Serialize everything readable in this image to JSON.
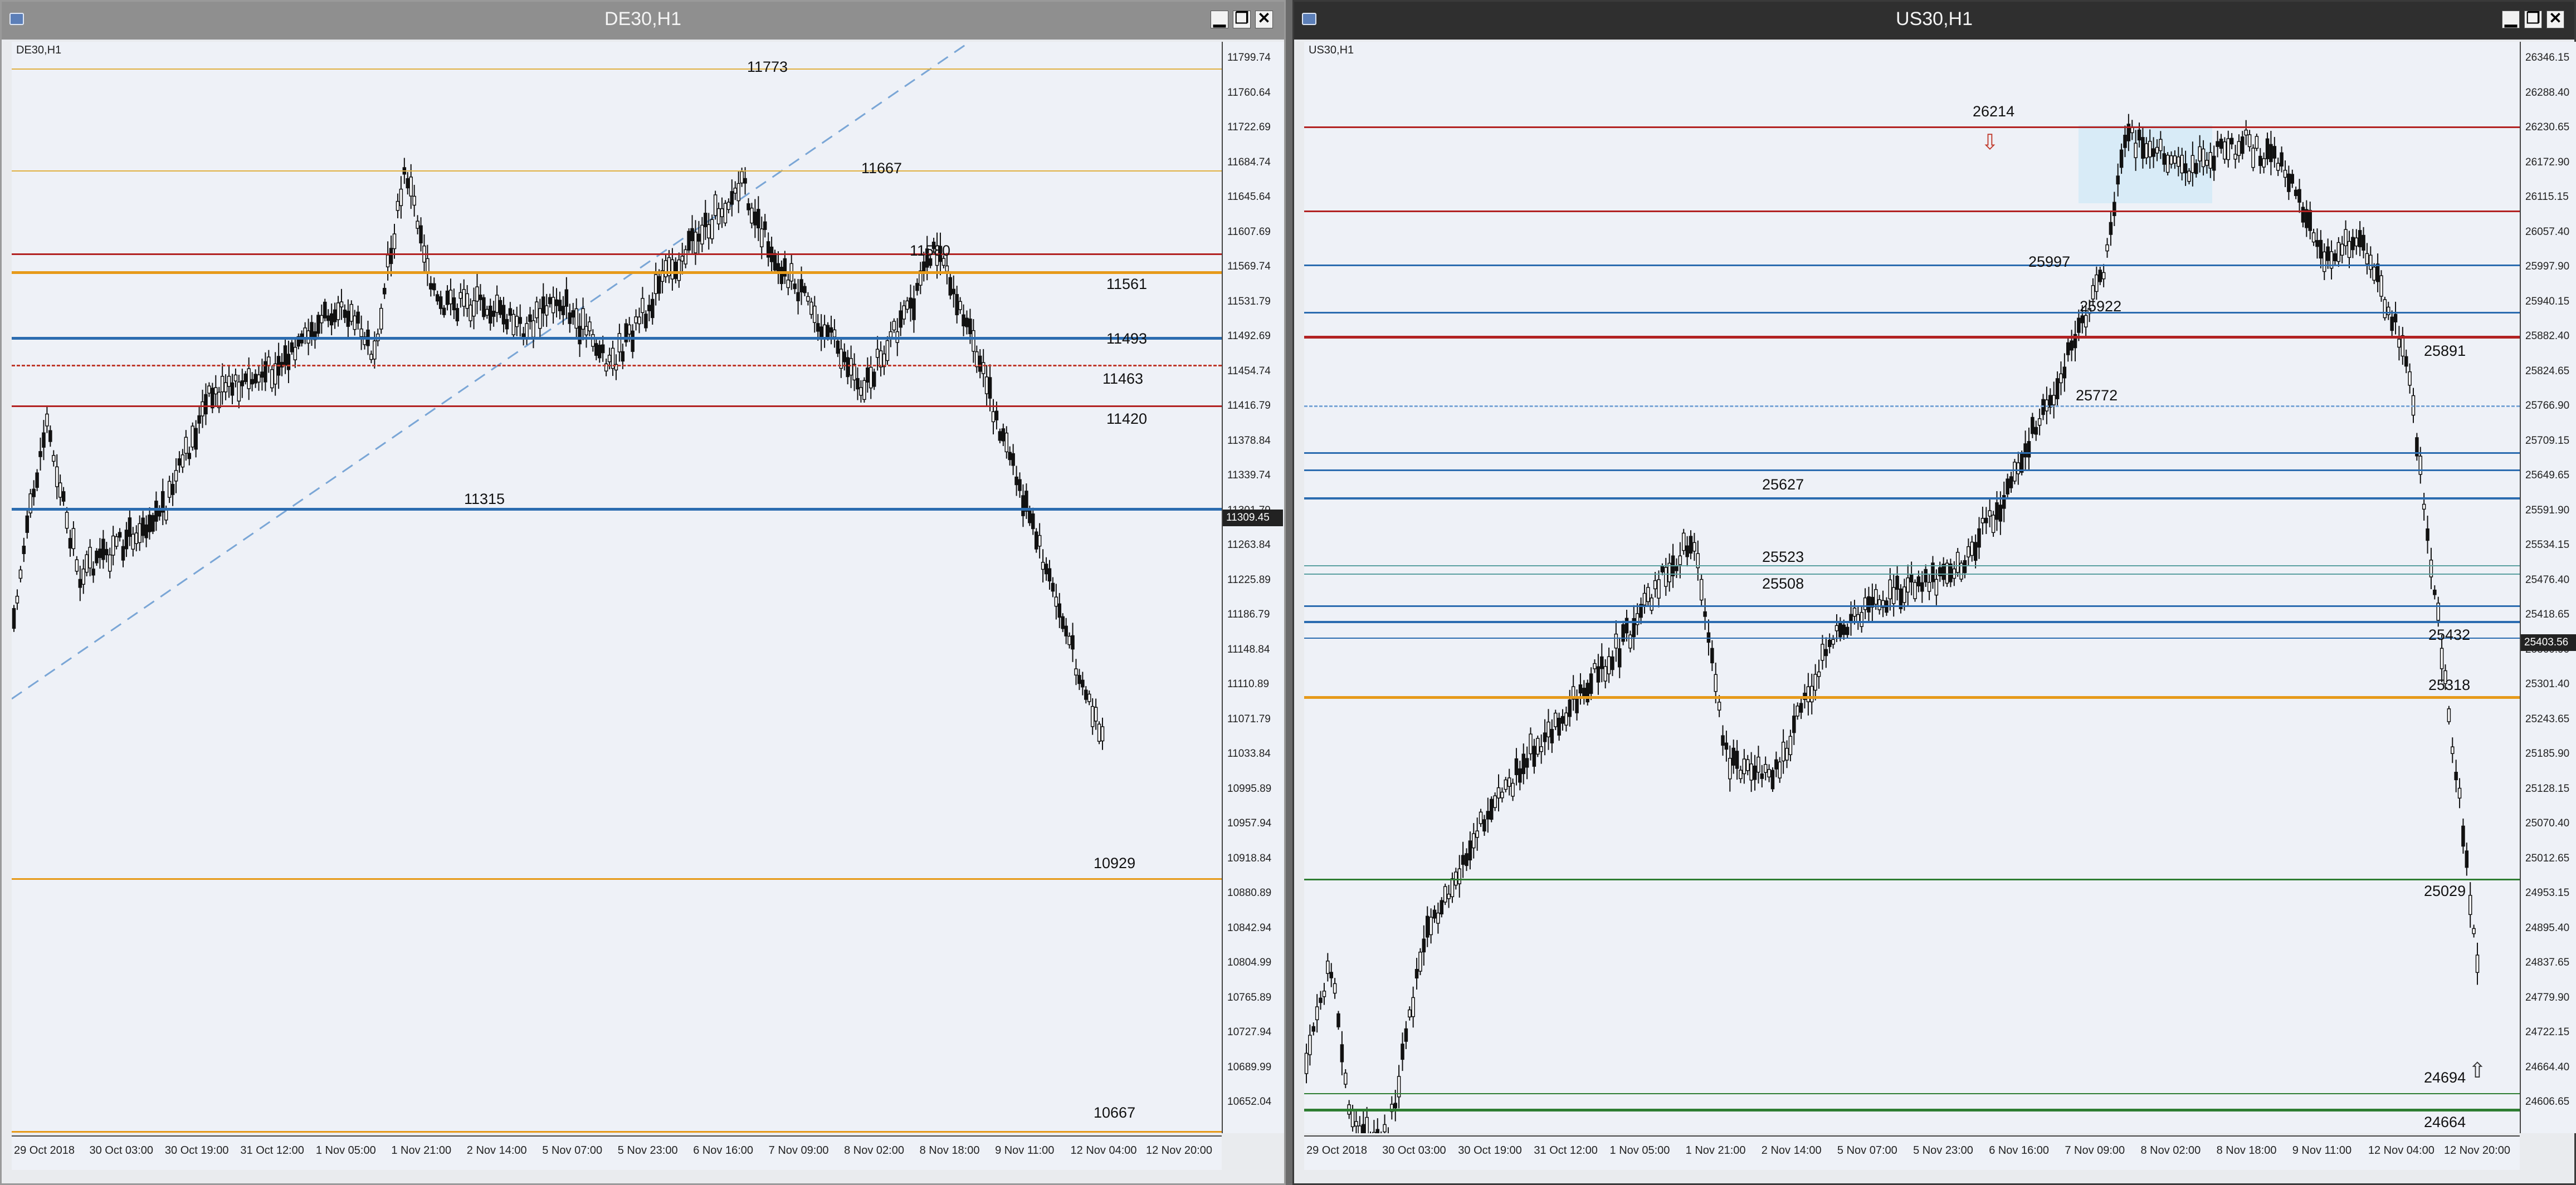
{
  "left": {
    "title": "DE30,H1",
    "symbol_label": "DE30,H1",
    "y_ticks": [
      "11799.74",
      "11760.64",
      "11722.69",
      "11684.74",
      "11645.64",
      "11607.69",
      "11569.74",
      "11531.79",
      "11492.69",
      "11454.74",
      "11416.79",
      "11378.84",
      "11339.74",
      "11301.79",
      "11263.84",
      "11225.89",
      "11186.79",
      "11148.84",
      "11110.89",
      "11071.79",
      "11033.84",
      "10995.89",
      "10957.94",
      "10918.84",
      "10880.89",
      "10842.94",
      "10804.99",
      "10765.89",
      "10727.94",
      "10689.99",
      "10652.04"
    ],
    "current_price": "11309.45",
    "x_ticks": [
      "29 Oct 2018",
      "30 Oct 03:00",
      "30 Oct 19:00",
      "31 Oct 12:00",
      "1 Nov 05:00",
      "1 Nov 21:00",
      "2 Nov 14:00",
      "5 Nov 07:00",
      "5 Nov 23:00",
      "6 Nov 16:00",
      "7 Nov 09:00",
      "8 Nov 02:00",
      "8 Nov 18:00",
      "9 Nov 11:00",
      "12 Nov 04:00",
      "12 Nov 20:00"
    ],
    "levels": [
      {
        "label": "11773",
        "color": "#e0b040"
      },
      {
        "label": "11667",
        "color": "#e0b040"
      },
      {
        "label": "11580",
        "color": "#b22222"
      },
      {
        "label": "11561",
        "color": "#e69a1a"
      },
      {
        "label": "11493",
        "color": "#2b6cb0"
      },
      {
        "label": "11463",
        "color": "#c0392b"
      },
      {
        "label": "11420",
        "color": "#b22222"
      },
      {
        "label": "11315",
        "color": "#2b6cb0"
      },
      {
        "label": "10929",
        "color": "#e69a1a"
      },
      {
        "label": "10667",
        "color": "#e69a1a"
      }
    ]
  },
  "right": {
    "title": "US30,H1",
    "symbol_label": "US30,H1",
    "y_ticks": [
      "26346.15",
      "26288.40",
      "26230.65",
      "26172.90",
      "26115.15",
      "26057.40",
      "25997.90",
      "25940.15",
      "25882.40",
      "25824.65",
      "25766.90",
      "25709.15",
      "25649.65",
      "25591.90",
      "25534.15",
      "25476.40",
      "25418.65",
      "25360.90",
      "25301.40",
      "25243.65",
      "25185.90",
      "25128.15",
      "25070.40",
      "25012.65",
      "24953.15",
      "24895.40",
      "24837.65",
      "24779.90",
      "24722.15",
      "24664.40",
      "24606.65"
    ],
    "current_price": "25403.56",
    "x_ticks": [
      "29 Oct 2018",
      "30 Oct 03:00",
      "30 Oct 19:00",
      "31 Oct 12:00",
      "1 Nov 05:00",
      "1 Nov 21:00",
      "2 Nov 14:00",
      "5 Nov 07:00",
      "5 Nov 23:00",
      "6 Nov 16:00",
      "7 Nov 09:00",
      "8 Nov 02:00",
      "8 Nov 18:00",
      "9 Nov 11:00",
      "12 Nov 04:00",
      "12 Nov 20:00"
    ],
    "levels": [
      {
        "label": "26214",
        "color": "#b22222"
      },
      {
        "label": "25997",
        "color": "#2b6cb0"
      },
      {
        "label": "25922",
        "color": "#2b6cb0"
      },
      {
        "label": "25891",
        "color": "#b22222"
      },
      {
        "label": "25772",
        "color": "#7aa6d6"
      },
      {
        "label": "25627",
        "color": "#2b6cb0"
      },
      {
        "label": "25523",
        "color": "#5aa0a0"
      },
      {
        "label": "25508",
        "color": "#2b6cb0"
      },
      {
        "label": "25432",
        "color": "#2b6cb0"
      },
      {
        "label": "25318",
        "color": "#e69a1a"
      },
      {
        "label": "25029",
        "color": "#2e7d32"
      },
      {
        "label": "24694",
        "color": "#2e7d32"
      },
      {
        "label": "24664",
        "color": "#2e7d32"
      }
    ]
  },
  "icons": {
    "minimize": "minimize-icon",
    "restore": "restore-icon",
    "close": "close-icon",
    "sell_arrow": "down-arrow-icon",
    "buy_arrow": "up-arrow-icon"
  },
  "window_buttons": {
    "minimize": "▁",
    "restore": "❐",
    "close": "✕"
  },
  "arrows": {
    "down": "⇩",
    "up": "⇧"
  }
}
